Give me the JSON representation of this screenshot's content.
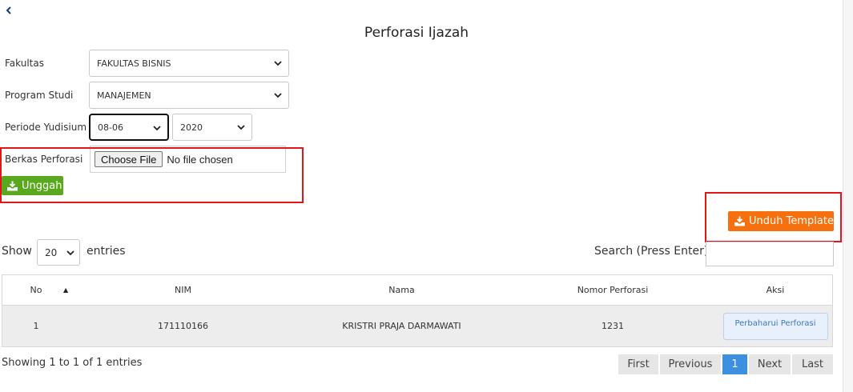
{
  "page": {
    "title": "Perforasi Ijazah"
  },
  "form": {
    "fakultas": {
      "label": "Fakultas",
      "value": "FAKULTAS BISNIS"
    },
    "prodi": {
      "label": "Program Studi",
      "value": "MANAJEMEN"
    },
    "periode": {
      "label": "Periode Yudisium",
      "value": "08-06",
      "year": "2020"
    },
    "berkas": {
      "label": "Berkas Perforasi",
      "choose_label": "Choose File",
      "file_text": "No file chosen"
    },
    "upload_label": "Unggah"
  },
  "toolbar": {
    "template_label": "Unduh Template"
  },
  "listing": {
    "show_label": "Show",
    "page_size": "20",
    "entries_label": "entries",
    "search_label": "Search (Press Enter):"
  },
  "table": {
    "headers": {
      "no": "No",
      "nim": "NIM",
      "nama": "Nama",
      "nomor": "Nomor Perforasi",
      "aksi": "Aksi"
    },
    "rows": [
      {
        "no": "1",
        "nim": "171110166",
        "nama": "KRISTRI PRAJA DARMAWATI",
        "nomor": "1231",
        "action": "Perbaharui Perforasi"
      }
    ]
  },
  "footer": {
    "info": "Showing 1 to 1 of 1 entries",
    "pager": {
      "first": "First",
      "previous": "Previous",
      "current": "1",
      "next": "Next",
      "last": "Last"
    }
  },
  "colors": {
    "green": "#59a81e",
    "orange": "#f6700e",
    "highlight": "#e0161b",
    "active_page": "#3d8fe0"
  },
  "icons": {
    "back": "chevron-left-icon",
    "upload": "download-tray-icon",
    "select": "chevron-down-icon"
  }
}
